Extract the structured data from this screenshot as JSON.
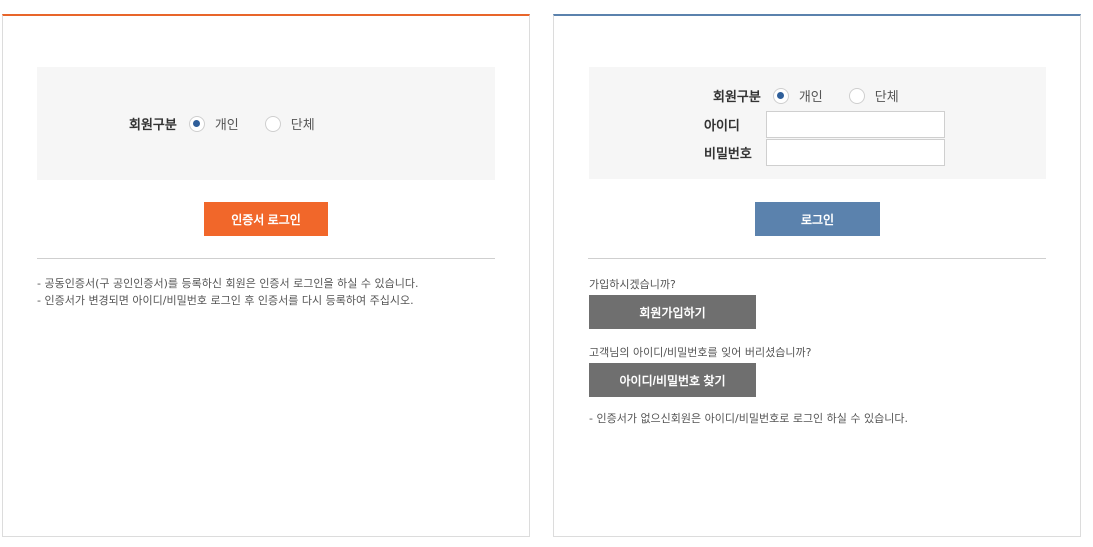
{
  "left_panel": {
    "member_type_label": "회원구분",
    "options": [
      "개인",
      "단체"
    ],
    "selected_option": "개인",
    "login_button": "인증서 로그인",
    "notes": [
      "-  공동인증서(구 공인인증서)를 등록하신 회원은 인증서 로그인을 하실 수 있습니다.",
      "-  인증서가 변경되면 아이디/비밀번호 로그인 후 인증서를 다시 등록하여 주십시오."
    ]
  },
  "right_panel": {
    "member_type_label": "회원구분",
    "options": [
      "개인",
      "단체"
    ],
    "selected_option": "개인",
    "id_label": "아이디",
    "id_value": "",
    "pw_label": "비밀번호",
    "pw_value": "",
    "login_button": "로그인",
    "signup_question": "가입하시겠습니까?",
    "signup_button": "회원가입하기",
    "find_question": "고객님의 아이디/비밀번호를 잊어 버리셨습니까?",
    "find_button": "아이디/비밀번호 찾기",
    "note": "-  인증서가 없으신회원은 아이디/비밀번호로 로그인 하실 수 있습니다."
  },
  "colors": {
    "accent_orange": "#f1672a",
    "accent_blue": "#5b82ad",
    "button_gray": "#6f6f6f"
  }
}
